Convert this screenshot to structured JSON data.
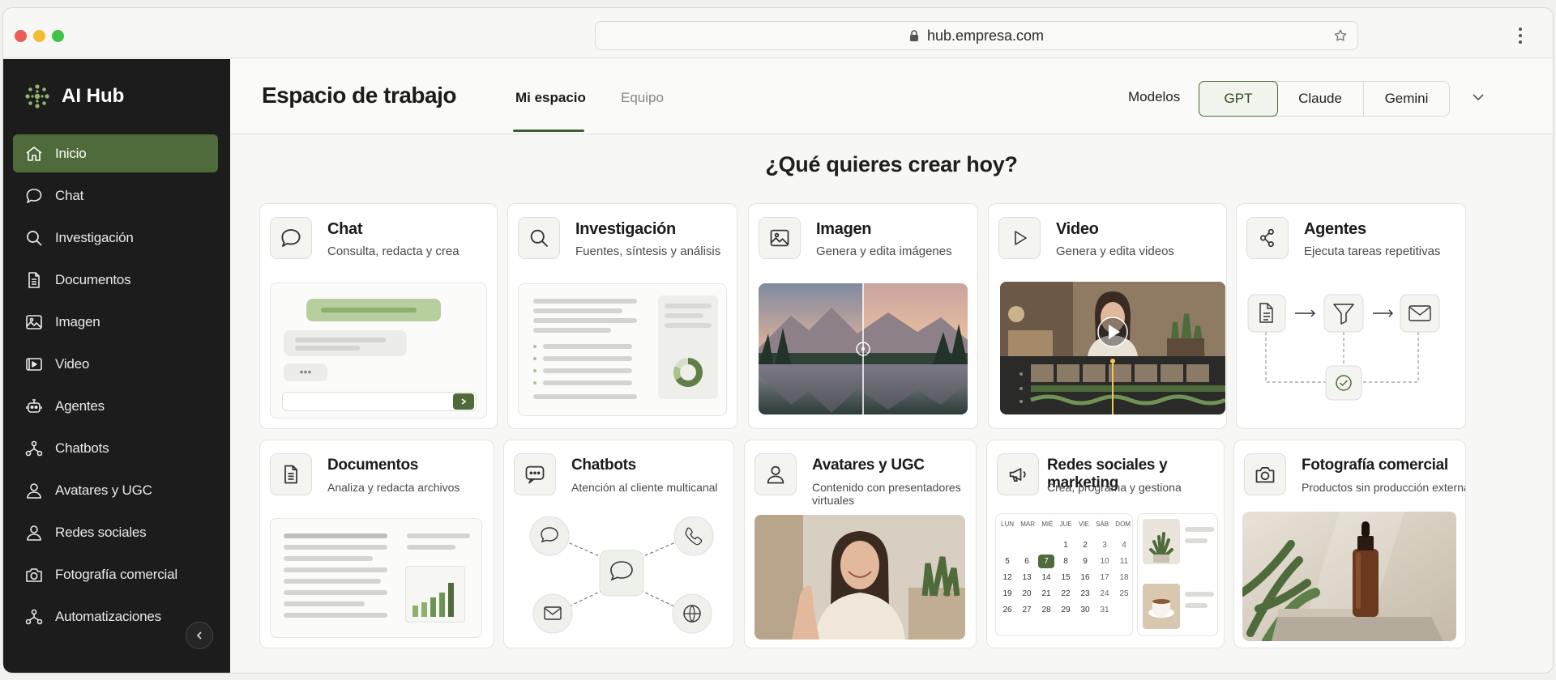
{
  "browser": {
    "url": "hub.empresa.com"
  },
  "sidebar": {
    "brand": "AI Hub",
    "items": [
      {
        "label": "Inicio",
        "icon": "home-icon",
        "active": true
      },
      {
        "label": "Chat",
        "icon": "chat-bubble-icon"
      },
      {
        "label": "Investigación",
        "icon": "search-icon"
      },
      {
        "label": "Documentos",
        "icon": "document-icon"
      },
      {
        "label": "Imagen",
        "icon": "image-icon"
      },
      {
        "label": "Video",
        "icon": "video-icon"
      },
      {
        "label": "Agentes",
        "icon": "robot-icon"
      },
      {
        "label": "Chatbots",
        "icon": "nodes-icon"
      },
      {
        "label": "Avatares y UGC",
        "icon": "user-icon"
      },
      {
        "label": "Redes sociales",
        "icon": "user-icon"
      },
      {
        "label": "Fotografía comercial",
        "icon": "camera-icon"
      },
      {
        "label": "Automatizaciones",
        "icon": "nodes-icon"
      }
    ]
  },
  "header": {
    "title": "Espacio de trabajo",
    "tabs": [
      {
        "label": "Mi espacio",
        "active": true
      },
      {
        "label": "Equipo",
        "active": false
      }
    ],
    "models_label": "Modelos",
    "models": [
      "GPT",
      "Claude",
      "Gemini"
    ],
    "selected_model": "GPT"
  },
  "main": {
    "headline": "¿Qué quieres crear hoy?",
    "cards": [
      {
        "title": "Chat",
        "subtitle": "Consulta, redacta y crea",
        "icon": "chat-bubble-icon"
      },
      {
        "title": "Investigación",
        "subtitle": "Fuentes, síntesis y análisis",
        "icon": "search-icon"
      },
      {
        "title": "Imagen",
        "subtitle": "Genera y edita imágenes",
        "icon": "image-icon"
      },
      {
        "title": "Video",
        "subtitle": "Genera y edita videos",
        "icon": "play-icon"
      },
      {
        "title": "Agentes",
        "subtitle": "Ejecuta tareas repetitivas",
        "icon": "share-nodes-icon"
      },
      {
        "title": "Documentos",
        "subtitle": "Analiza y redacta archivos",
        "icon": "document-icon"
      },
      {
        "title": "Chatbots",
        "subtitle": "Atención al cliente multicanal",
        "icon": "chat-dots-icon"
      },
      {
        "title": "Avatares y UGC",
        "subtitle": "Contenido con presentadores virtuales",
        "icon": "user-icon"
      },
      {
        "title": "Redes sociales y marketing",
        "subtitle": "Crea, programa y gestiona",
        "icon": "megaphone-icon"
      },
      {
        "title": "Fotografía comercial",
        "subtitle": "Productos sin producción externa",
        "icon": "camera-icon"
      }
    ],
    "calendar": {
      "weekdays": [
        "LUN",
        "MAR",
        "MIÉ",
        "JUE",
        "VIE",
        "SÁB",
        "DOM"
      ],
      "rows": [
        [
          "",
          "",
          "",
          "1",
          "2",
          "3",
          "4"
        ],
        [
          "5",
          "6",
          "7",
          "8",
          "9",
          "10",
          "11"
        ],
        [
          "12",
          "13",
          "14",
          "15",
          "16",
          "17",
          "18"
        ],
        [
          "19",
          "20",
          "21",
          "22",
          "23",
          "24",
          "25"
        ],
        [
          "26",
          "27",
          "28",
          "29",
          "30",
          "31",
          ""
        ]
      ],
      "highlighted_day": "7"
    }
  },
  "colors": {
    "accent": "#4f6b3c",
    "sidebar_bg": "#1c1c1c",
    "accent_light": "#a9c48f"
  }
}
